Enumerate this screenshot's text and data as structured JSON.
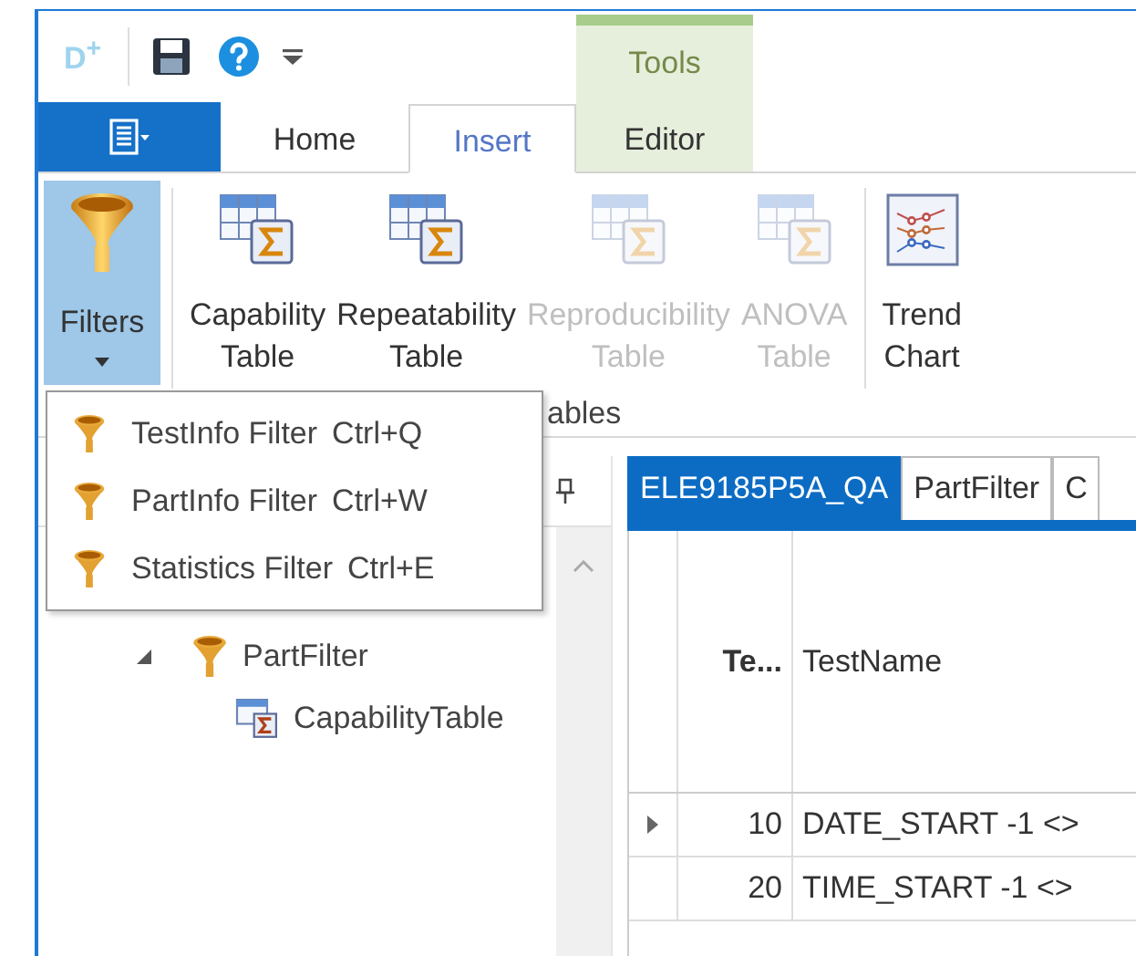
{
  "quick_access": {
    "logo": "D$^{+}$"
  },
  "contextual_group": {
    "label": "Tools"
  },
  "ribbon_tabs": [
    {
      "label": "Home",
      "selected": false,
      "contextual": false
    },
    {
      "label": "Insert",
      "selected": true,
      "contextual": false
    },
    {
      "label": "Editor",
      "selected": false,
      "contextual": true
    }
  ],
  "ribbon_buttons": [
    {
      "kind": "filter",
      "lines": [
        "Filters"
      ],
      "selected": true,
      "disabled": false,
      "dropdown": true
    },
    {
      "kind": "table",
      "lines": [
        "Capability",
        "Table"
      ],
      "selected": false,
      "disabled": false,
      "dropdown": false
    },
    {
      "kind": "table",
      "lines": [
        "Repeatability",
        "Table"
      ],
      "selected": false,
      "disabled": false,
      "dropdown": false
    },
    {
      "kind": "table",
      "lines": [
        "Reproducibility",
        "Table"
      ],
      "selected": false,
      "disabled": true,
      "dropdown": false
    },
    {
      "kind": "table",
      "lines": [
        "ANOVA",
        "Table"
      ],
      "selected": false,
      "disabled": true,
      "dropdown": false
    },
    {
      "kind": "chart",
      "lines": [
        "Trend",
        "Chart"
      ],
      "selected": false,
      "disabled": false,
      "dropdown": false
    }
  ],
  "ribbon_group_label": "ables",
  "filter_menu": [
    {
      "label": "TestInfo Filter",
      "shortcut": "Ctrl+Q"
    },
    {
      "label": "PartInfo Filter",
      "shortcut": "Ctrl+W"
    },
    {
      "label": "Statistics Filter",
      "shortcut": "Ctrl+E"
    }
  ],
  "tree": [
    {
      "kind": "filter",
      "label": "PartFilter",
      "expanded": true,
      "children": [
        {
          "kind": "table",
          "label": "CapabilityTable"
        }
      ]
    }
  ],
  "document_tabs": [
    {
      "label": "ELE9185P5A_QA",
      "selected": true
    },
    {
      "label": "PartFilter",
      "selected": false
    },
    {
      "label": "C",
      "selected": false
    }
  ],
  "grid": {
    "columns": [
      {
        "label": "Te...",
        "bold": true
      },
      {
        "label": "TestName",
        "bold": false
      }
    ],
    "rows": [
      {
        "current": true,
        "cells": [
          "10",
          "DATE_START  -1 <>"
        ]
      },
      {
        "current": false,
        "cells": [
          "20",
          "TIME_START  -1 <>"
        ]
      }
    ]
  }
}
